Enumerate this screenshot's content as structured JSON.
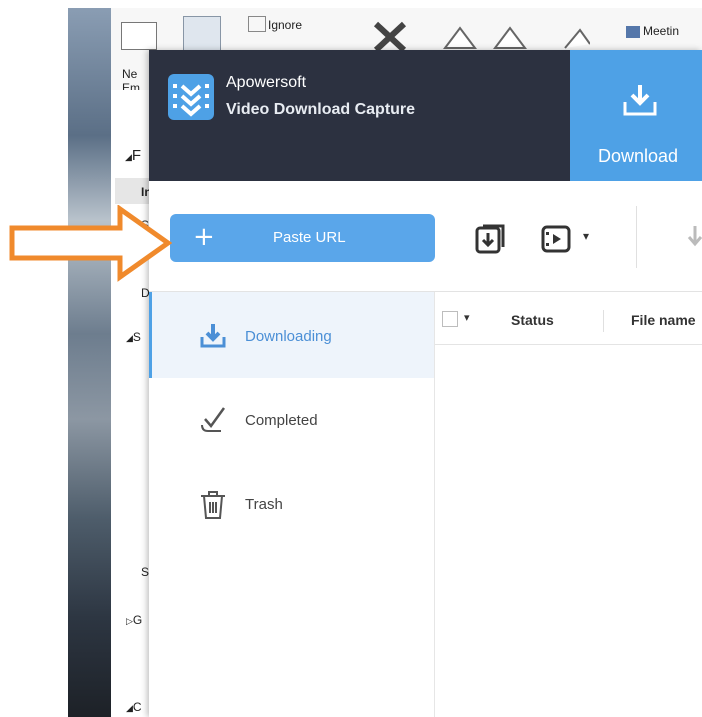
{
  "outlook": {
    "ribbon_labels": [
      "Ne",
      "Em",
      "Ignore",
      "Meetin"
    ],
    "left_letters": [
      "F",
      "In",
      "S",
      "D",
      "S",
      "S",
      "G",
      "C"
    ]
  },
  "app": {
    "brand": "Apowersoft",
    "name": "Video Download Capture",
    "tab_download": "Download"
  },
  "toolbar": {
    "paste_plus": "+",
    "paste_label": "Paste URL",
    "dropdown_caret": "▾"
  },
  "sidebar": {
    "items": [
      {
        "label": "Downloading",
        "icon": "download-icon",
        "active": true
      },
      {
        "label": "Completed",
        "icon": "checkmark-icon",
        "active": false
      },
      {
        "label": "Trash",
        "icon": "trash-icon",
        "active": false
      }
    ]
  },
  "table": {
    "columns": [
      "Status",
      "File name"
    ],
    "header_caret": "▾"
  },
  "colors": {
    "accent": "#4ea1e6",
    "header_bg": "#2c3140",
    "arrow": "#f08a2c"
  }
}
